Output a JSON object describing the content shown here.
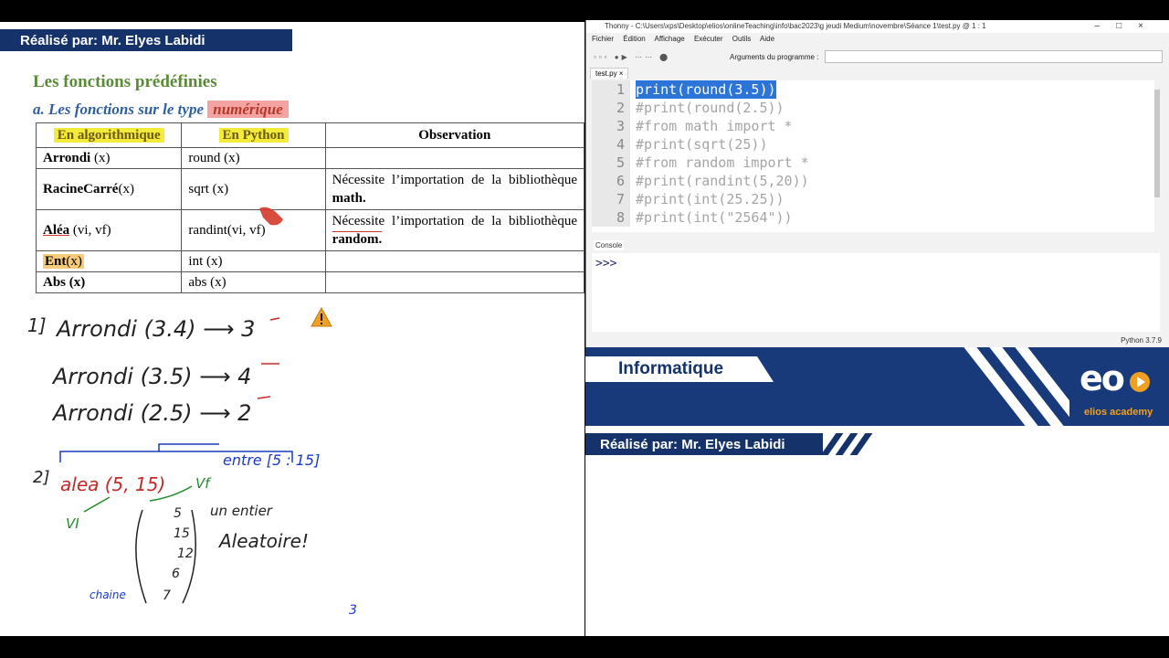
{
  "doc": {
    "header": "Réalisé par: Mr. Elyes Labidi",
    "title": "Les fonctions prédéfinies",
    "subtitle_prefix": "a.  Les fonctions sur le type",
    "subtitle_highlight": "numérique",
    "table": {
      "headers": [
        "En algorithmique",
        "En Python",
        "Observation"
      ],
      "rows": [
        {
          "algo_bold": "Arrondi",
          "algo_rest": " (x)",
          "py": "round (x)",
          "obs": "",
          "obs_bold": ""
        },
        {
          "algo_bold": "RacineCarré",
          "algo_rest": "(x)",
          "py": "sqrt (x)",
          "obs": "Nécessite l’importation de la bibliothèque ",
          "obs_bold": "math."
        },
        {
          "algo_bold": "Aléa",
          "algo_rest": " (vi, vf)",
          "py": "randint(vi, vf)",
          "obs": "Nécessite l’importation de la bibliothèque ",
          "obs_bold": "random."
        },
        {
          "algo_bold": "Ent",
          "algo_rest": "(x)",
          "py": "int (x)",
          "obs": "",
          "obs_bold": ""
        },
        {
          "algo_bold": "Abs",
          "algo_rest": " (x)",
          "py": "abs (x)",
          "obs": "",
          "obs_bold": ""
        }
      ]
    },
    "notes": {
      "n1": "1]",
      "l1": "Arrondi (3.4) ⟶ 3",
      "l2": "Arrondi (3.5) ⟶ 4",
      "l3": "Arrondi (2.5) ⟶ 2",
      "n2": "2]",
      "alea": "alea (5, 15)",
      "entre": "entre [5 : 15]",
      "vi": "VI",
      "vf": "Vf",
      "values": [
        "5",
        "15",
        "12",
        "6",
        "7"
      ],
      "entier": "un entier",
      "aleatoire": "Aleatoire!",
      "chaine": "chaine",
      "three": "3"
    }
  },
  "thonny": {
    "titlebar": "Thonny  -  C:\\Users\\xps\\Desktop\\elios\\onlineTeaching\\info\\bac2023\\g jeudi Medium\\novembre\\Séance 1\\test.py  @  1 : 1",
    "menu": [
      "Fichier",
      "Édition",
      "Affichage",
      "Exécuter",
      "Outils",
      "Aide"
    ],
    "args_label": "Arguments du programme :",
    "tab": "test.py  ×",
    "code": [
      "print(round(3.5))",
      "#print(round(2.5))",
      "#from math import *",
      "#print(sqrt(25))",
      "#from random import *",
      "#print(randint(5,20))",
      "#print(int(25.25))",
      "#print(int(\"2564\"))"
    ],
    "line_numbers": [
      "1",
      "2",
      "3",
      "4",
      "5",
      "6",
      "7",
      "8"
    ],
    "console_label": "Console",
    "prompt": ">>>",
    "status": "Python 3.7.9"
  },
  "brand": {
    "label": "Informatique",
    "logo": "eo",
    "logo_text": "elios academy",
    "footer": "Réalisé par: Mr. Elyes Labidi"
  },
  "colors": {
    "navy": "#15336a",
    "selection": "#2c74d8",
    "title_green": "#5b8a3a",
    "accent_orange": "#f0a020"
  }
}
